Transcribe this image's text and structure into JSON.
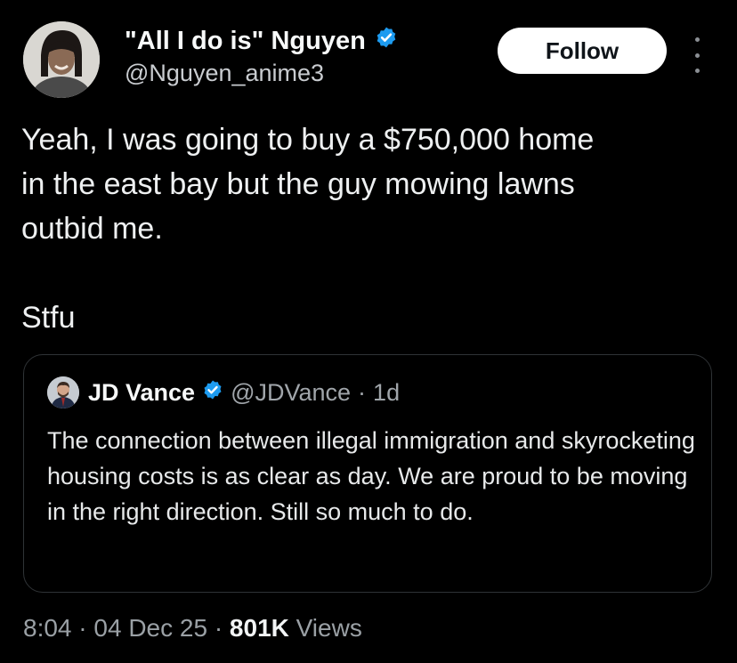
{
  "author": {
    "display_name": "\"All I do is\" Nguyen",
    "handle": "@Nguyen_anime3",
    "verified": true
  },
  "actions": {
    "follow_label": "Follow"
  },
  "tweet": {
    "text": "Yeah, I was going to buy a $750,000 home\nin the east bay but the guy mowing lawns\noutbid me.\n\nStfu"
  },
  "quote": {
    "display_name": "JD Vance",
    "handle": "@JDVance",
    "separator": "·",
    "time": "1d",
    "verified": true,
    "text": "The connection between illegal immigration and skyrocketing housing costs is as clear as day. We are proud to be moving in the right direction. Still so much to do."
  },
  "meta": {
    "time": "8:04",
    "sep1": "·",
    "date": "04 Dec 25",
    "sep2": "·",
    "views_count": "801K",
    "views_label": "Views"
  },
  "colors": {
    "background": "#000000",
    "verified_badge": "#1d9bf0",
    "follow_bg": "#ffffff"
  },
  "icons": [
    "verified-badge-icon",
    "more-options-icon"
  ]
}
